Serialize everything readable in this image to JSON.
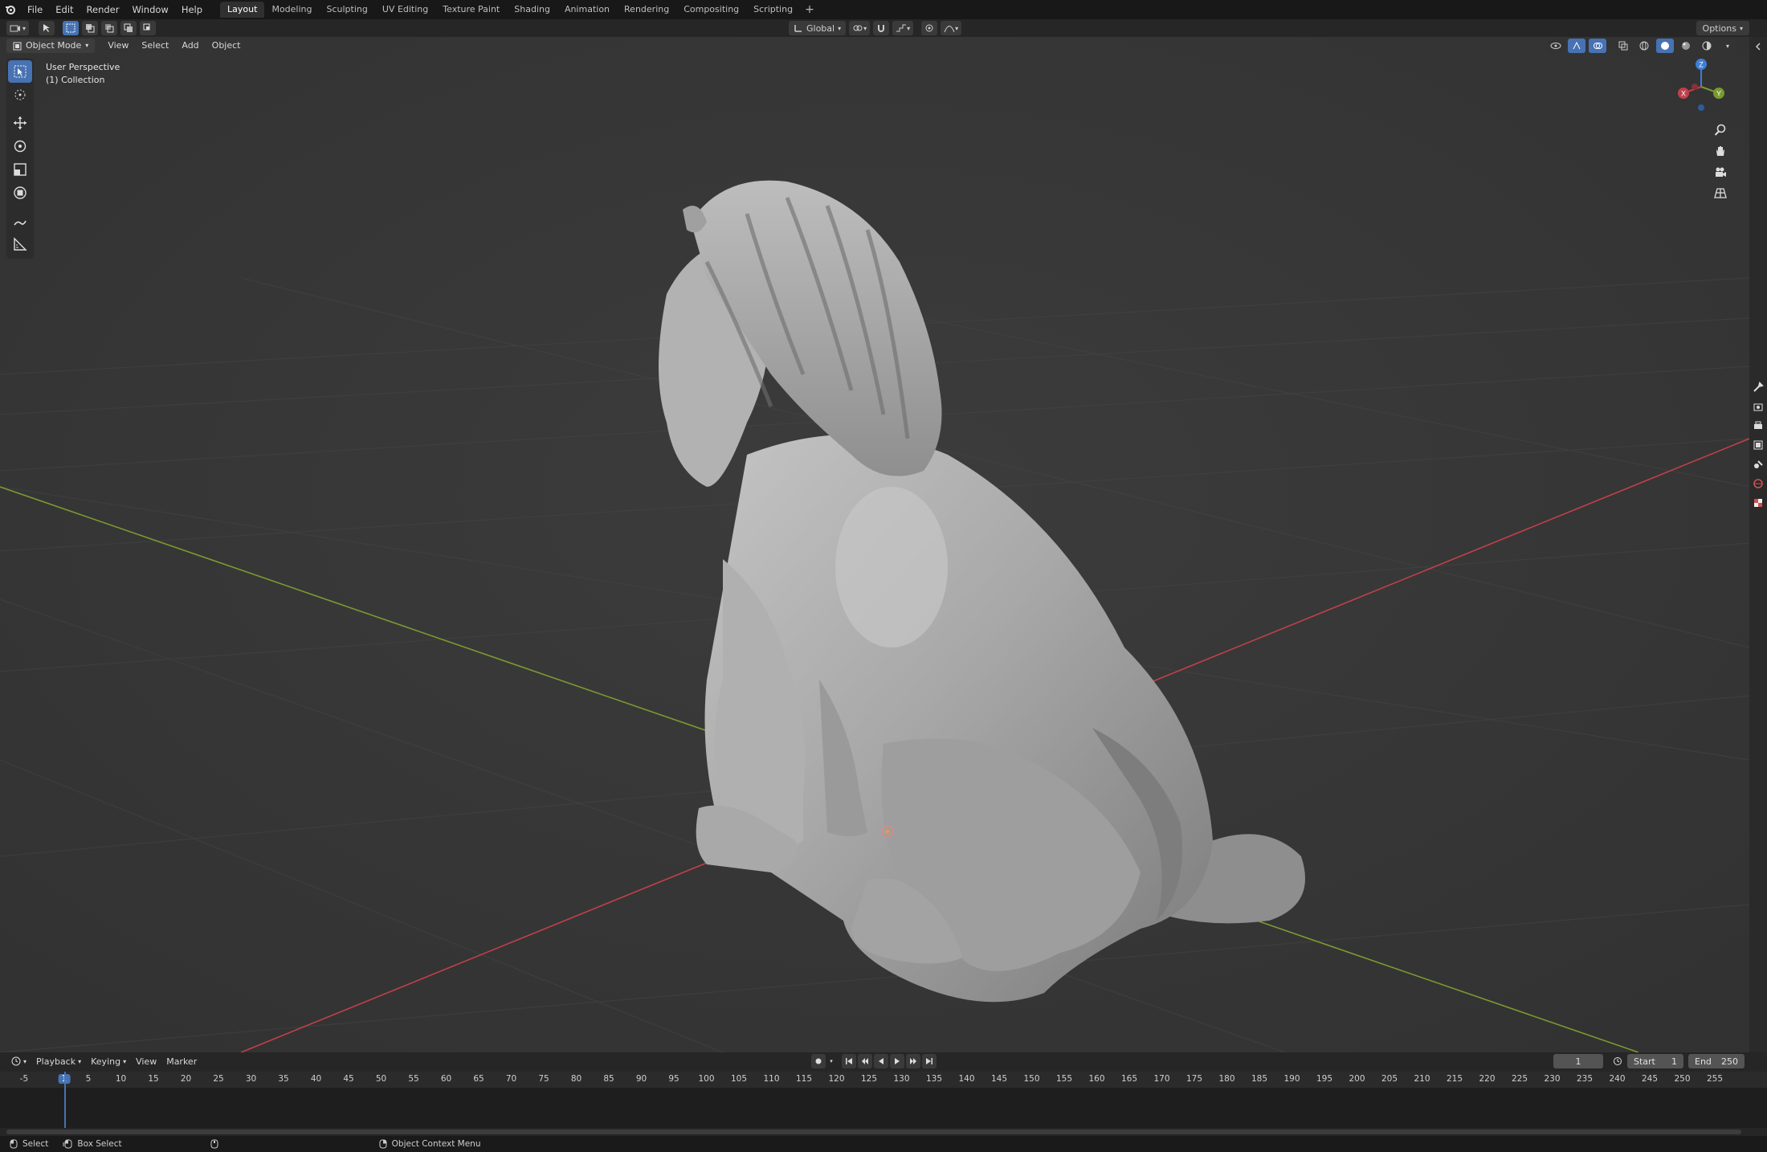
{
  "topbar": {
    "menus": [
      "File",
      "Edit",
      "Render",
      "Window",
      "Help"
    ],
    "workspaces": [
      "Layout",
      "Modeling",
      "Sculpting",
      "UV Editing",
      "Texture Paint",
      "Shading",
      "Animation",
      "Rendering",
      "Compositing",
      "Scripting"
    ],
    "active_workspace": "Layout",
    "add_label": "+"
  },
  "toolheader": {
    "orientation": "Global",
    "options_label": "Options"
  },
  "viewport": {
    "mode": "Object Mode",
    "menus": [
      "View",
      "Select",
      "Add",
      "Object"
    ],
    "perspective_label": "User Perspective",
    "collection_label": "(1) Collection",
    "gizmo": {
      "x": "X",
      "y": "Y",
      "z": "Z"
    },
    "colors": {
      "x_axis": "#c0404b",
      "y_axis": "#7a9a30",
      "z_axis": "#3d7fd6",
      "background": "#393939",
      "grid": "#444444",
      "active": "#4772b3"
    }
  },
  "timeline": {
    "menus": [
      "Playback",
      "Keying",
      "View",
      "Marker"
    ],
    "current_frame": "1",
    "start_label": "Start",
    "start_value": "1",
    "end_label": "End",
    "end_value": "250",
    "ticks": [
      "-5",
      "1",
      "5",
      "10",
      "15",
      "20",
      "25",
      "30",
      "35",
      "40",
      "45",
      "50",
      "55",
      "60",
      "65",
      "70",
      "75",
      "80",
      "85",
      "90",
      "95",
      "100",
      "105",
      "110",
      "115",
      "120",
      "125",
      "130",
      "135",
      "140",
      "145",
      "150",
      "155",
      "160",
      "165",
      "170",
      "175",
      "180",
      "185",
      "190",
      "195",
      "200",
      "205",
      "210",
      "215",
      "220",
      "225",
      "230",
      "235",
      "240",
      "245",
      "250",
      "255"
    ]
  },
  "statusbar": {
    "select": "Select",
    "box_select": "Box Select",
    "context_menu": "Object Context Menu"
  }
}
